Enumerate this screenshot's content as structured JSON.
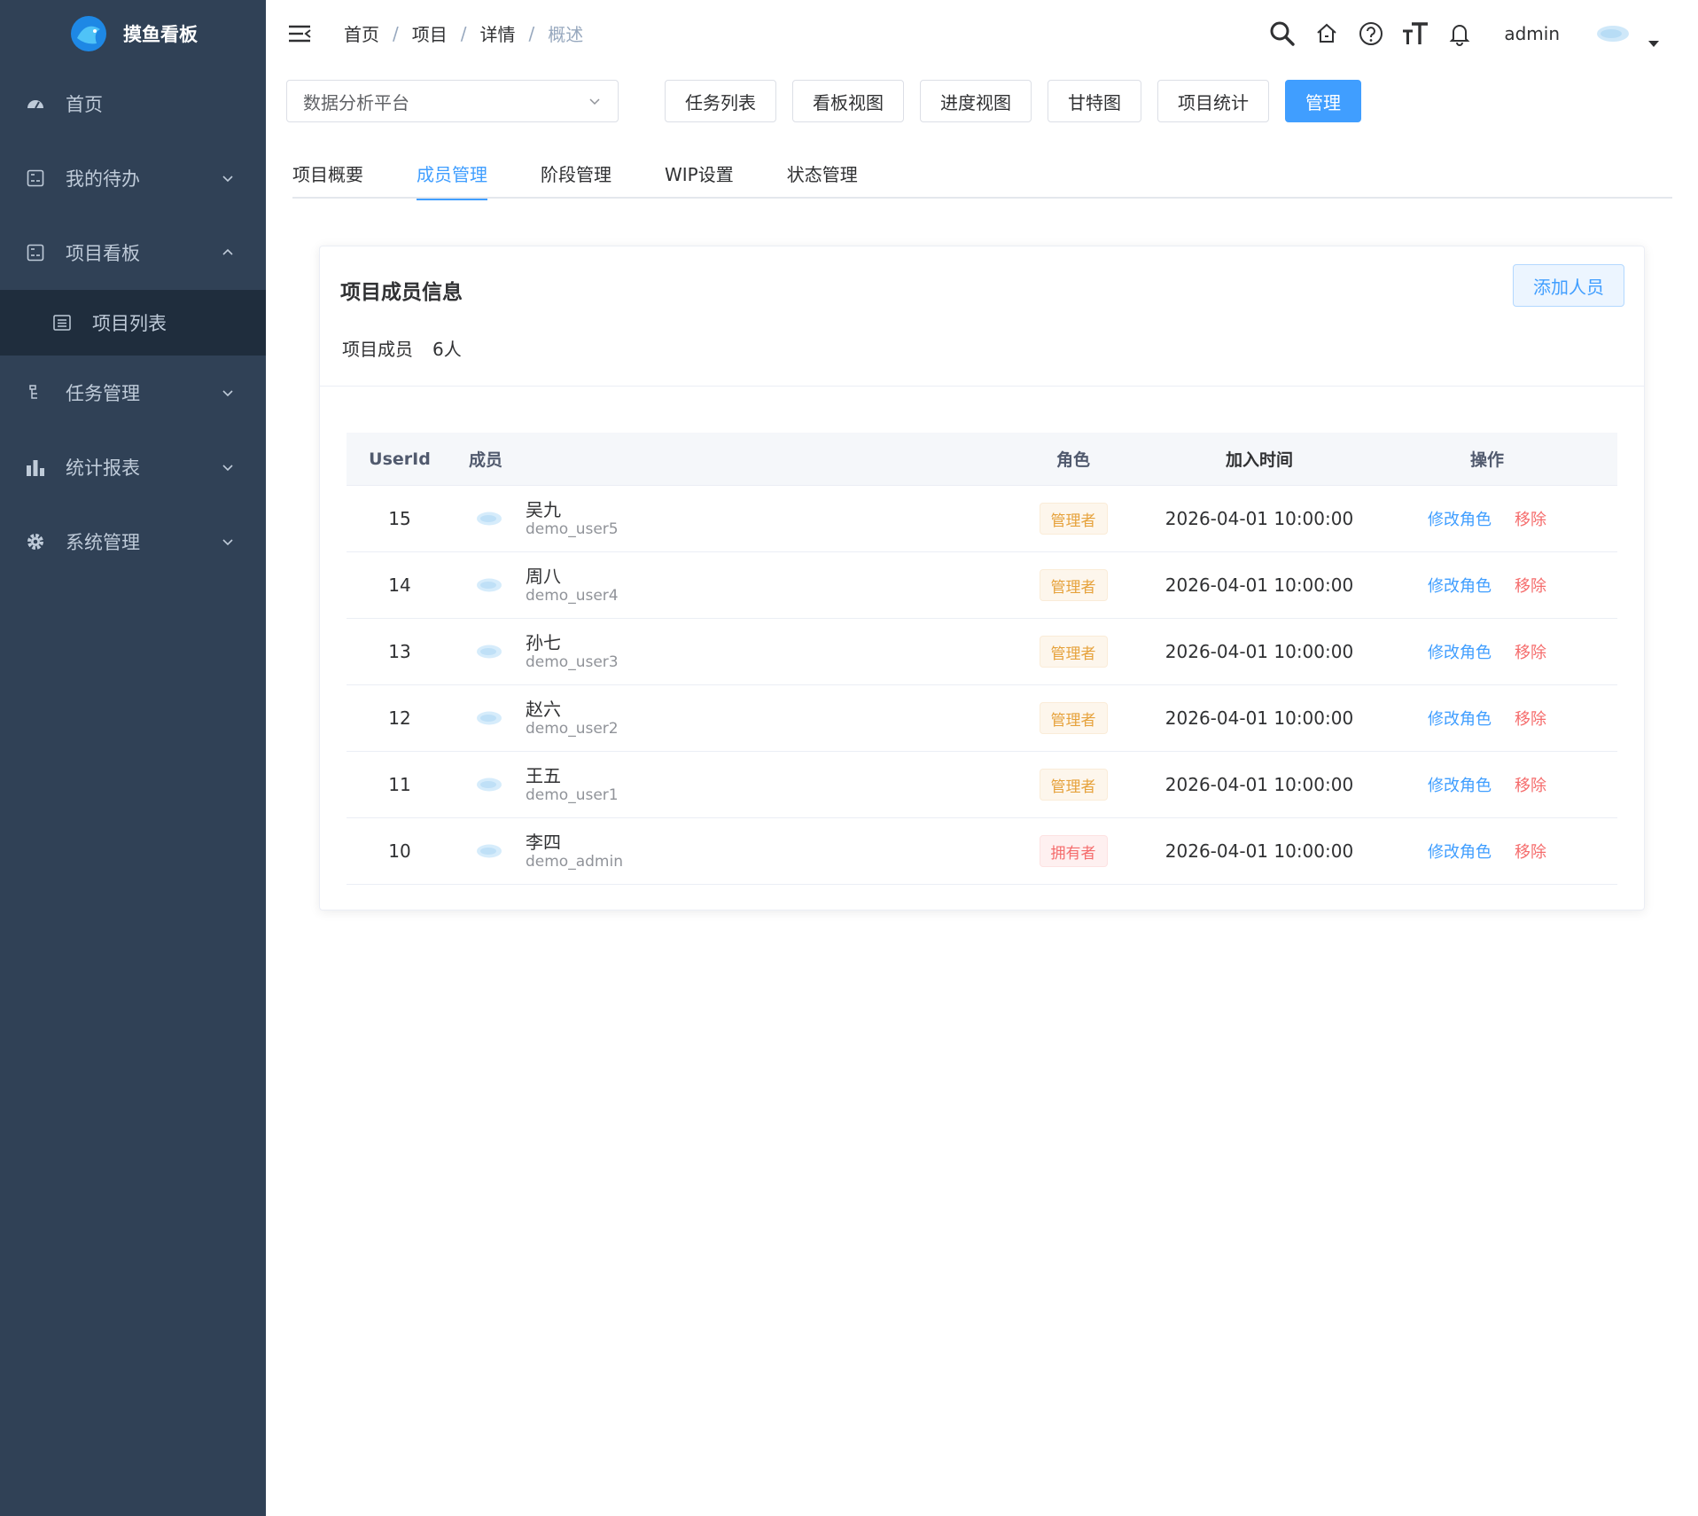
{
  "app": {
    "name": "摸鱼看板"
  },
  "sidebar": {
    "items": [
      {
        "label": "首页"
      },
      {
        "label": "我的待办"
      },
      {
        "label": "项目看板",
        "children": [
          {
            "label": "项目列表"
          }
        ]
      },
      {
        "label": "任务管理"
      },
      {
        "label": "统计报表"
      },
      {
        "label": "系统管理"
      }
    ]
  },
  "header": {
    "breadcrumb": [
      "首页",
      "项目",
      "详情",
      "概述"
    ],
    "user": "admin"
  },
  "toolbar": {
    "project_select": "数据分析平台",
    "buttons": [
      "任务列表",
      "看板视图",
      "进度视图",
      "甘特图",
      "项目统计",
      "管理"
    ]
  },
  "tabs": [
    "项目概要",
    "成员管理",
    "阶段管理",
    "WIP设置",
    "状态管理"
  ],
  "card": {
    "title": "项目成员信息",
    "add_button": "添加人员",
    "member_count_label": "项目成员",
    "member_count_value": "6人"
  },
  "table": {
    "headers": {
      "id": "UserId",
      "member": "成员",
      "role": "角色",
      "time": "加入时间",
      "op": "操作"
    },
    "edit_label": "修改角色",
    "remove_label": "移除",
    "rows": [
      {
        "id": "15",
        "name": "吴九",
        "username": "demo_user5",
        "role": "管理者",
        "time": "2026-04-01 10:00:00"
      },
      {
        "id": "14",
        "name": "周八",
        "username": "demo_user4",
        "role": "管理者",
        "time": "2026-04-01 10:00:00"
      },
      {
        "id": "13",
        "name": "孙七",
        "username": "demo_user3",
        "role": "管理者",
        "time": "2026-04-01 10:00:00"
      },
      {
        "id": "12",
        "name": "赵六",
        "username": "demo_user2",
        "role": "管理者",
        "time": "2026-04-01 10:00:00"
      },
      {
        "id": "11",
        "name": "王五",
        "username": "demo_user1",
        "role": "管理者",
        "time": "2026-04-01 10:00:00"
      },
      {
        "id": "10",
        "name": "李四",
        "username": "demo_admin",
        "role": "拥有者",
        "time": "2026-04-01 10:00:00"
      }
    ]
  },
  "colors": {
    "sidebar_bg": "#304156",
    "primary": "#409eff",
    "warning": "#e6a23c",
    "danger": "#f56c6c"
  }
}
